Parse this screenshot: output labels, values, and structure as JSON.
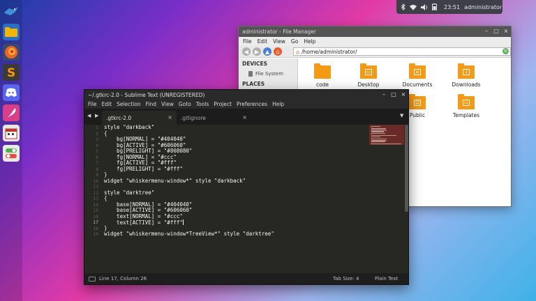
{
  "panel": {
    "clock": "23:51",
    "user": "administrator",
    "icons": [
      "bluetooth-icon",
      "wifi-icon",
      "volume-icon",
      "battery-icon"
    ]
  },
  "dock": {
    "items": [
      "whisker-menu-icon",
      "files-icon",
      "firefox-icon",
      "sublime-icon",
      "discord-icon",
      "feather-icon",
      "calendar-icon",
      "settings-toggle-icon"
    ]
  },
  "file_manager": {
    "title": "administrator - File Manager",
    "menu": [
      "File",
      "Edit",
      "View",
      "Go",
      "Help"
    ],
    "location": "/home/administrator/",
    "sidebar": {
      "devices_header": "DEVICES",
      "file_system": "File System",
      "places_header": "PLACES"
    },
    "files": [
      {
        "name": "code",
        "emblem": ""
      },
      {
        "name": "Desktop",
        "emblem": "▭"
      },
      {
        "name": "Documents",
        "emblem": "≡"
      },
      {
        "name": "Downloads",
        "emblem": "↓"
      },
      {
        "name": "Public",
        "emblem": "☺"
      },
      {
        "name": "Templates",
        "emblem": "▭"
      }
    ],
    "colors": {
      "folder": "#f39a17",
      "titlebar": "#545454"
    }
  },
  "sublime": {
    "title": "~/.gtkrc-2.0 - Sublime Text (UNREGISTERED)",
    "menu": [
      "File",
      "Edit",
      "Selection",
      "Find",
      "View",
      "Goto",
      "Tools",
      "Project",
      "Preferences",
      "Help"
    ],
    "tabs": [
      {
        "label": ".gtkrc-2.0",
        "active": true
      },
      {
        "label": ".gitignore",
        "active": false
      }
    ],
    "line_numbers": [
      "1",
      "2",
      "3",
      "4",
      "5",
      "6",
      "7",
      "8",
      "9",
      "10",
      "11",
      "12",
      "13",
      "14",
      "15",
      "16",
      "17",
      "18",
      "19"
    ],
    "code_lines": [
      "style \"darkback\"",
      "{",
      "    bg[NORMAL] = \"#404040\"",
      "    bg[ACTIVE] = \"#606060\"",
      "    bg[PRELIGHT] = \"#808080\"",
      "    fg[NORMAL] = \"#ccc\"",
      "    fg[ACTIVE] = \"#fff\"",
      "    fg[PRELIGHT] = \"#fff\"",
      "}",
      "widget \"whiskermenu-window*\" style \"darkback\"",
      "",
      "style \"darktree\"",
      "{",
      "    base[NORMAL] = \"#404040\"",
      "    base[ACTIVE] = \"#606060\"",
      "    text[NORMAL] = \"#ccc\"",
      "    text[ACTIVE] = \"#fff\"",
      "}",
      "widget \"whiskermenu-window*TreeView*\" style \"darktree\""
    ],
    "current_line": 17,
    "status": {
      "position": "Line 17, Column 26",
      "tab_size": "Tab Size: 4",
      "syntax": "Plain Text"
    },
    "colors": {
      "background": "#272822",
      "text": "#f8f8f2",
      "minimap_highlight": "#6a2a26"
    }
  }
}
